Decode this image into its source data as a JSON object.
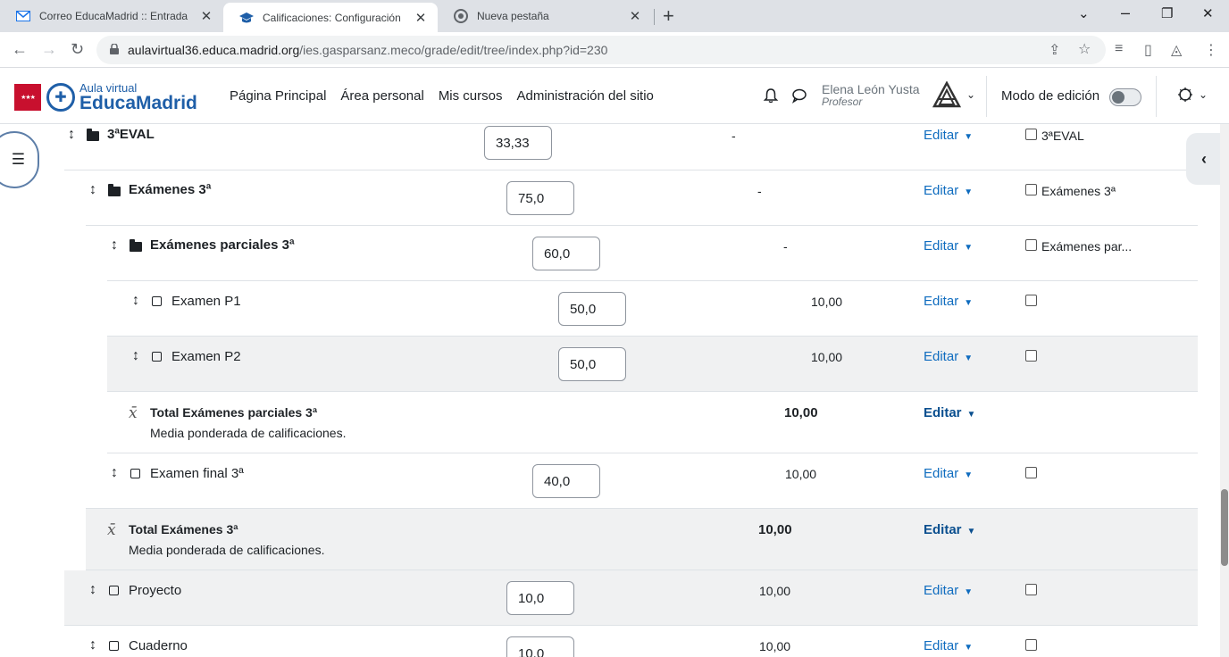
{
  "browser": {
    "tabs": [
      {
        "title": "Correo EducaMadrid :: Entrada",
        "icon": "mail-icon"
      },
      {
        "title": "Calificaciones: Configuración",
        "icon": "moodle-cap-icon"
      },
      {
        "title": "Nueva pestaña",
        "icon": "chrome-icon"
      }
    ],
    "url_host": "aulavirtual36.educa.madrid.org",
    "url_path": "/ies.gasparsanz.meco/grade/edit/tree/index.php?id=230"
  },
  "navbar": {
    "logo_sub": "Aula virtual",
    "logo_main": "EducaMadrid",
    "menu": [
      "Página Principal",
      "Área personal",
      "Mis cursos",
      "Administración del sitio"
    ],
    "user_name": "Elena León Yusta",
    "user_role": "Profesor",
    "edit_mode_label": "Modo de edición",
    "edit_mode_on": false
  },
  "grades": {
    "edit_label": "Editar",
    "rows": [
      {
        "name": "3ªEVAL",
        "weight": "33,33",
        "max": "-",
        "select_label": "3ªEVAL"
      },
      {
        "name": "Exámenes 3ª",
        "weight": "75,0",
        "max": "-",
        "select_label": "Exámenes 3ª"
      },
      {
        "name": "Exámenes parciales 3ª",
        "weight": "60,0",
        "max": "-",
        "select_label": "Exámenes par..."
      },
      {
        "name": "Examen P1",
        "weight": "50,0",
        "max": "10,00"
      },
      {
        "name": "Examen P2",
        "weight": "50,0",
        "max": "10,00"
      },
      {
        "name": "Total Exámenes parciales 3ª",
        "sub": "Media ponderada de calificaciones.",
        "max": "10,00"
      },
      {
        "name": "Examen final 3ª",
        "weight": "40,0",
        "max": "10,00"
      },
      {
        "name": "Total Exámenes 3ª",
        "sub": "Media ponderada de calificaciones.",
        "max": "10,00"
      },
      {
        "name": "Proyecto",
        "weight": "10,0",
        "max": "10,00"
      },
      {
        "name": "Cuaderno",
        "weight": "10,0",
        "max": "10,00"
      }
    ]
  }
}
